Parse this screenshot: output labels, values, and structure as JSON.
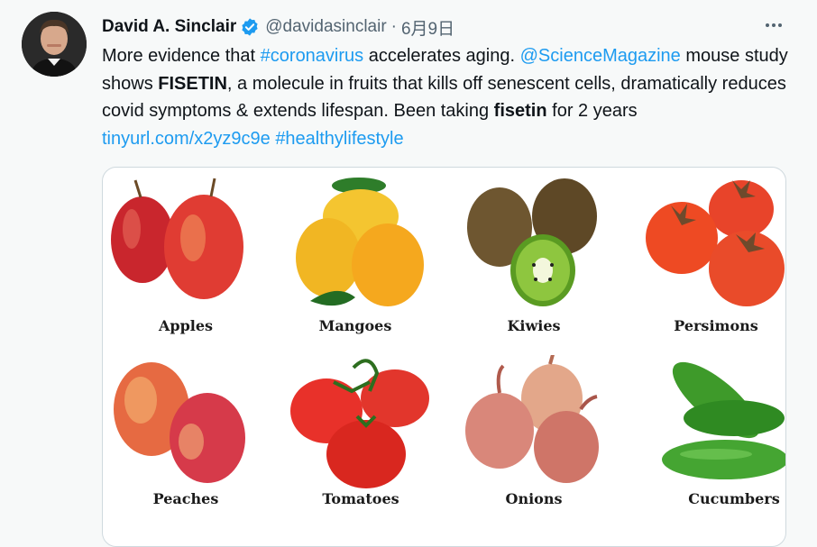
{
  "tweet": {
    "display_name": "David A. Sinclair",
    "handle": "@davidasinclair",
    "separator": "·",
    "date": "6月9日",
    "text": {
      "t1": "More evidence that ",
      "hashtag1": "#coronavirus",
      "t2": " accelerates aging. ",
      "mention": "@ScienceMagazine",
      "t3": " mouse study shows ",
      "bold1": "FISETIN",
      "t4": ", a molecule in fruits that kills off senescent cells, dramatically reduces covid symptoms & extends lifespan. Been taking ",
      "bold2": "fisetin",
      "t5": " for 2 years ",
      "url": "tinyurl.com/x2yz9c9e",
      "t6": " ",
      "hashtag2": "#healthylifestyle"
    }
  },
  "media": {
    "fruits": [
      {
        "label": "Apples",
        "color": "#d8343a"
      },
      {
        "label": "Mangoes",
        "color": "#f3b21f"
      },
      {
        "label": "Kiwies",
        "color": "#6e5630"
      },
      {
        "label": "Persimons",
        "color": "#ee4a23"
      },
      {
        "label": "Peaches",
        "color": "#e25b4b"
      },
      {
        "label": "Tomatoes",
        "color": "#e8312a"
      },
      {
        "label": "Onions",
        "color": "#d9877a"
      },
      {
        "label": "Cucumbers",
        "color": "#3f9a2c"
      }
    ]
  },
  "icons": {
    "verified": "verified-badge-icon",
    "more": "more-options-icon"
  },
  "colors": {
    "link": "#1d9bf0",
    "secondary_text": "#536471",
    "verified": "#1d9bf0"
  }
}
